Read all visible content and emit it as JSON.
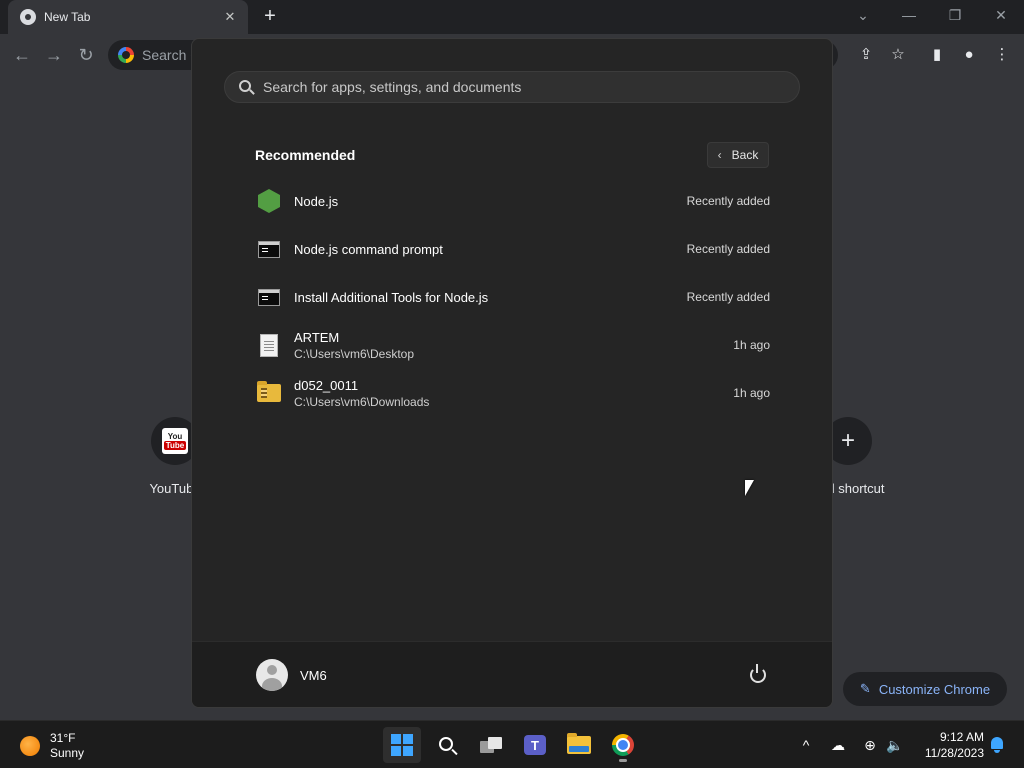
{
  "chrome": {
    "tab_title": "New Tab",
    "tab_close": "✕",
    "new_tab": "+",
    "omnibox_placeholder": "Search G",
    "controls": {
      "minimize": "—",
      "restore": "❐",
      "close": "✕",
      "tab_search": "⌄"
    }
  },
  "new_tab_page": {
    "shortcuts": [
      {
        "label": "YouTube",
        "icon": "youtube-icon"
      },
      {
        "label": "Add shortcut",
        "icon": "plus-icon"
      }
    ],
    "customize_label": "Customize Chrome"
  },
  "start_menu": {
    "search_placeholder": "Search for apps, settings, and documents",
    "section_title": "Recommended",
    "back_label": "Back",
    "items": [
      {
        "name": "Node.js",
        "sub": "",
        "time": "Recently added",
        "icon": "nodejs-icon"
      },
      {
        "name": "Node.js command prompt",
        "sub": "",
        "time": "Recently added",
        "icon": "command-prompt-icon"
      },
      {
        "name": "Install Additional Tools for Node.js",
        "sub": "",
        "time": "Recently added",
        "icon": "command-prompt-icon"
      },
      {
        "name": "ARTEM",
        "sub": "C:\\Users\\vm6\\Desktop",
        "time": "1h ago",
        "icon": "document-icon"
      },
      {
        "name": "d052_0011",
        "sub": "C:\\Users\\vm6\\Downloads",
        "time": "1h ago",
        "icon": "zip-folder-icon"
      }
    ],
    "user_name": "VM6"
  },
  "taskbar": {
    "weather": {
      "temp": "31°F",
      "condition": "Sunny"
    },
    "clock": {
      "time": "9:12 AM",
      "date": "11/28/2023"
    },
    "tray_chevron": "^"
  },
  "colors": {
    "accent": "#3ea6ff",
    "link": "#8ab4f8",
    "node_green": "#539e43"
  }
}
